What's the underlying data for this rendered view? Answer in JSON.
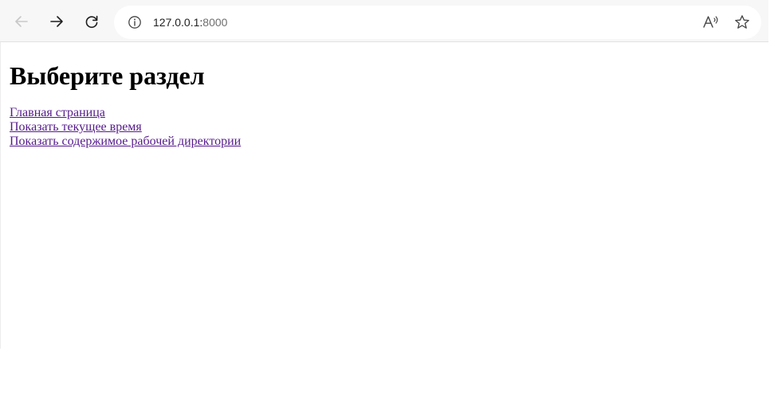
{
  "browser": {
    "url_host": "127.0.0.1:",
    "url_port": "8000",
    "icons": {
      "back": "arrow-left-icon",
      "forward": "arrow-right-icon",
      "reload": "reload-icon",
      "site_info": "info-icon",
      "read_aloud": "read-aloud-icon",
      "favorite": "star-icon"
    }
  },
  "page": {
    "heading": "Выберите раздел",
    "links": [
      {
        "label": "Главная страница"
      },
      {
        "label": "Показать текущее время"
      },
      {
        "label": "Показать содержимое рабочей директории"
      }
    ]
  },
  "colors": {
    "visited_link": "#551a8b",
    "toolbar_bg": "#f7f7f7"
  }
}
